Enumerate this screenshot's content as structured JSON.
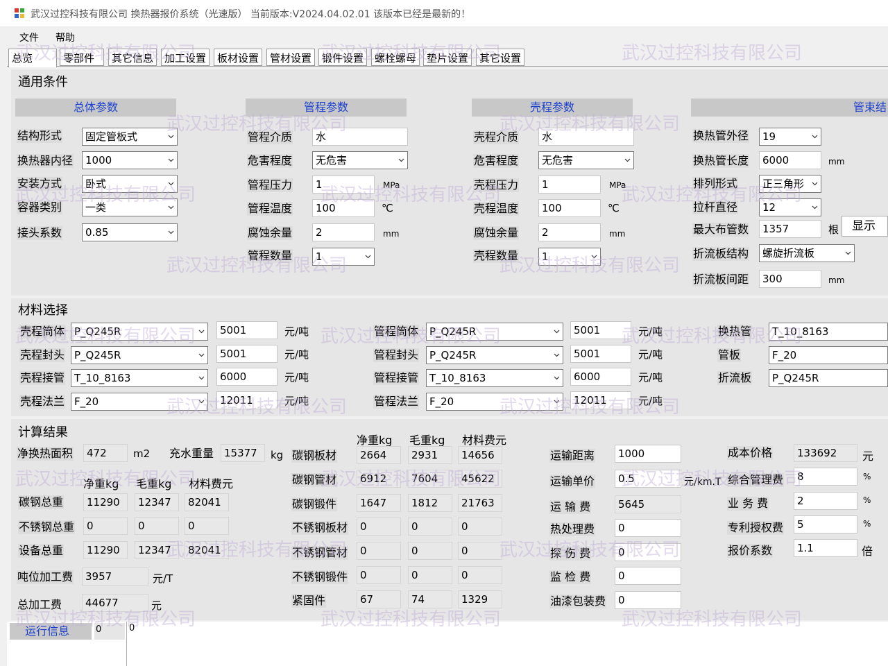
{
  "window": {
    "title": "武汉过控科技有限公司   换热器报价系统（光速版）   当前版本:V2024.04.02.01     该版本已经是最新的！"
  },
  "menu": {
    "file": "文件",
    "help": "帮助"
  },
  "tabs": [
    "总览",
    "零部件",
    "其它信息",
    "加工设置",
    "板材设置",
    "管材设置",
    "锻件设置",
    "螺栓螺母",
    "垫片设置",
    "其它设置"
  ],
  "watermark": "武汉过控科技有限公司",
  "general": {
    "section": "通用条件",
    "overall": {
      "header": "总体参数",
      "structure_label": "结构形式",
      "structure": "固定管板式",
      "diameter_label": "换热器内径",
      "diameter": "1000",
      "install_label": "安装方式",
      "install": "卧式",
      "vessel_label": "容器类别",
      "vessel": "一类",
      "joint_label": "接头系数",
      "joint": "0.85"
    },
    "tube": {
      "header": "管程参数",
      "medium_label": "管程介质",
      "medium": "水",
      "hazard_label": "危害程度",
      "hazard": "无危害",
      "pressure_label": "管程压力",
      "pressure": "1",
      "pressure_unit": "MPa",
      "temp_label": "管程温度",
      "temp": "100",
      "temp_unit": "℃",
      "corr_label": "腐蚀余量",
      "corr": "2",
      "corr_unit": "mm",
      "count_label": "管程数量",
      "count": "1"
    },
    "shell": {
      "header": "壳程参数",
      "medium_label": "壳程介质",
      "medium": "水",
      "hazard_label": "危害程度",
      "hazard": "无危害",
      "pressure_label": "壳程压力",
      "pressure": "1",
      "pressure_unit": "MPa",
      "temp_label": "壳程温度",
      "temp": "100",
      "temp_unit": "℃",
      "corr_label": "腐蚀余量",
      "corr": "2",
      "corr_unit": "mm",
      "count_label": "壳程数量",
      "count": "1"
    },
    "bundle": {
      "header": "管束结",
      "od_label": "换热管外径",
      "od": "19",
      "len_label": "换热管长度",
      "len": "6000",
      "len_unit": "mm",
      "arr_label": "排列形式",
      "arr": "正三角形",
      "rod_label": "拉杆直径",
      "rod": "12",
      "max_label": "最大布管数",
      "max": "1357",
      "max_unit": "根",
      "show": "显示",
      "baffle_label": "折流板结构",
      "baffle": "螺旋折流板",
      "spacing_label": "折流板间距",
      "spacing": "300",
      "spacing_unit": "mm"
    }
  },
  "materials": {
    "section": "材料选择",
    "unit": "元/吨",
    "shell": [
      {
        "label": "壳程筒体",
        "mat": "P_Q245R",
        "price": "5001"
      },
      {
        "label": "壳程封头",
        "mat": "P_Q245R",
        "price": "5001"
      },
      {
        "label": "壳程接管",
        "mat": "T_10_8163",
        "price": "6000"
      },
      {
        "label": "壳程法兰",
        "mat": "F_20",
        "price": "12011"
      }
    ],
    "tube": [
      {
        "label": "管程筒体",
        "mat": "P_Q245R",
        "price": "5001"
      },
      {
        "label": "管程封头",
        "mat": "P_Q245R",
        "price": "5001"
      },
      {
        "label": "管程接管",
        "mat": "T_10_8163",
        "price": "6000"
      },
      {
        "label": "管程法兰",
        "mat": "F_20",
        "price": "12011"
      }
    ],
    "other": [
      {
        "label": "换热管",
        "mat": "T_10_8163"
      },
      {
        "label": "管板",
        "mat": "F_20"
      },
      {
        "label": "折流板",
        "mat": "P_Q245R"
      }
    ]
  },
  "results": {
    "section": "计算结果",
    "area_label": "净换热面积",
    "area": "472",
    "area_unit": "m2",
    "water_label": "充水重量",
    "water": "15377",
    "water_unit": "kg",
    "col_net": "净重kg",
    "col_gross": "毛重kg",
    "col_cost": "材料费元",
    "left_rows": [
      {
        "label": "碳钢总重",
        "net": "11290",
        "gross": "12347",
        "cost": "82041"
      },
      {
        "label": "不锈钢总重",
        "net": "0",
        "gross": "0",
        "cost": "0"
      },
      {
        "label": "设备总重",
        "net": "11290",
        "gross": "12347",
        "cost": "82041"
      }
    ],
    "unit_proc_label": "吨位加工费",
    "unit_proc": "3957",
    "unit_proc_unit": "元/T",
    "total_proc_label": "总加工费",
    "total_proc": "44677",
    "total_proc_unit": "元",
    "mid_rows": [
      {
        "label": "碳钢板材",
        "net": "2664",
        "gross": "2931",
        "cost": "14656"
      },
      {
        "label": "碳钢管材",
        "net": "6912",
        "gross": "7604",
        "cost": "45622"
      },
      {
        "label": "碳钢锻件",
        "net": "1647",
        "gross": "1812",
        "cost": "21763"
      },
      {
        "label": "不锈钢板材",
        "net": "0",
        "gross": "0",
        "cost": "0"
      },
      {
        "label": "不锈钢管材",
        "net": "0",
        "gross": "0",
        "cost": "0"
      },
      {
        "label": "不锈钢锻件",
        "net": "0",
        "gross": "0",
        "cost": "0"
      },
      {
        "label": "紧固件",
        "net": "67",
        "gross": "74",
        "cost": "1329"
      }
    ],
    "transport_rows": [
      {
        "label": "运输距离",
        "value": "1000",
        "unit": ""
      },
      {
        "label": "运输单价",
        "value": "0.5",
        "unit": "元/km.T"
      },
      {
        "label": "运 输 费",
        "value": "5645",
        "unit": ""
      },
      {
        "label": "热处理费",
        "value": "0",
        "unit": ""
      },
      {
        "label": "探 伤 费",
        "value": "0",
        "unit": ""
      },
      {
        "label": "监 检 费",
        "value": "0",
        "unit": ""
      },
      {
        "label": "油漆包装费",
        "value": "0",
        "unit": ""
      }
    ],
    "price_rows": [
      {
        "label": "成本价格",
        "value": "133692",
        "unit": "元"
      },
      {
        "label": "综合管理费",
        "value": "8",
        "unit": "%"
      },
      {
        "label": "业 务 费",
        "value": "2",
        "unit": "%"
      },
      {
        "label": "专利授权费",
        "value": "5",
        "unit": "%"
      },
      {
        "label": "报价系数",
        "value": "1.1",
        "unit": "倍"
      }
    ]
  },
  "run": {
    "label": "运行信息",
    "a": "0",
    "b": "0"
  }
}
